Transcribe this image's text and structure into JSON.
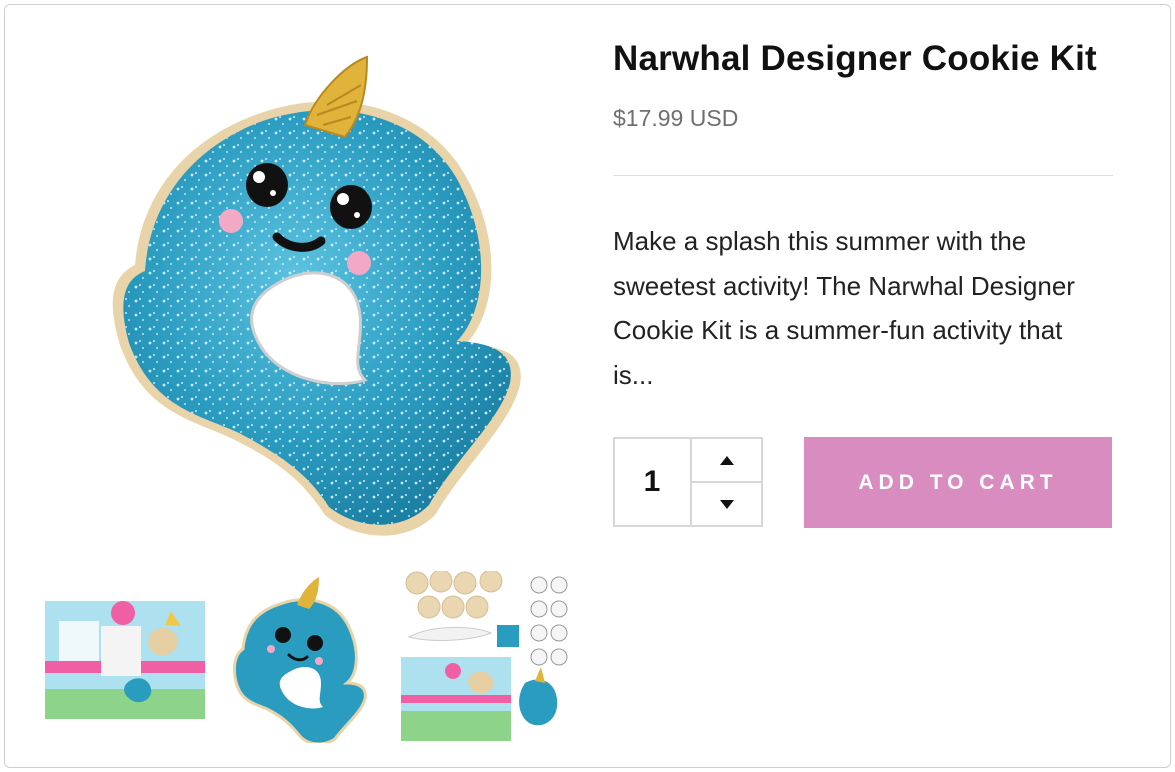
{
  "product": {
    "title": "Narwhal Designer Cookie Kit",
    "price": "$17.99 USD",
    "description": "Make a splash this summer with the sweetest activity! The Narwhal Designer Cookie Kit is a summer-fun activity that is..."
  },
  "quantity": {
    "value": "1",
    "increment_icon": "caret-up-icon",
    "decrement_icon": "caret-down-icon"
  },
  "cart": {
    "add_label": "ADD TO CART"
  },
  "gallery": {
    "main_image": "narwhal-cookie",
    "thumbnails": [
      "kit-box",
      "narwhal-cookie",
      "kit-contents"
    ]
  },
  "colors": {
    "accent": "#d98cbf",
    "cookie_blue": "#2a9cc0",
    "horn_gold": "#e0b43a",
    "price_gray": "#6f6f6f"
  }
}
